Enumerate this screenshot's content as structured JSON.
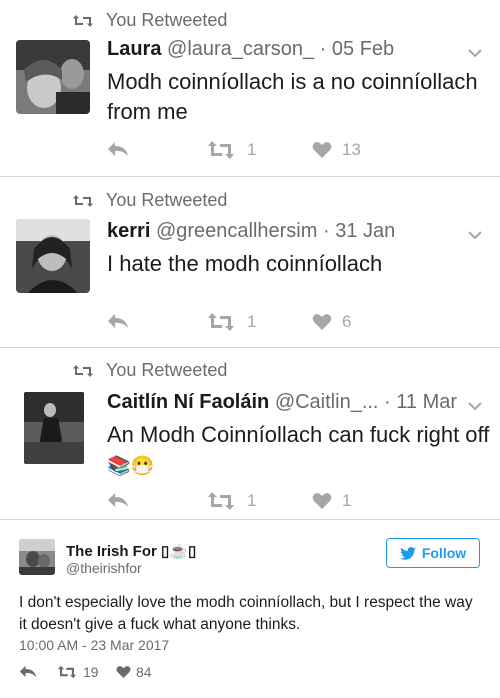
{
  "retweet_label": "You Retweeted",
  "tweets": [
    {
      "name": "Laura",
      "handle": "@laura_carson_",
      "date": "05 Feb",
      "text": "Modh coinníollach is a no coinníollach from me",
      "emoji": "",
      "retweets": "1",
      "likes": "13"
    },
    {
      "name": "kerri",
      "handle": "@greencallhersim",
      "date": "31 Jan",
      "text": "I hate the modh coinníollach",
      "emoji": "",
      "retweets": "1",
      "likes": "6"
    },
    {
      "name": "Caitlín Ní Faoláin",
      "handle": "@Caitlin_...",
      "date": "11 Mar",
      "text": "An Modh Coinníollach can fuck right off",
      "emoji": "📚😷",
      "retweets": "1",
      "likes": "1"
    }
  ],
  "embed": {
    "name": "The Irish For ▯☕▯",
    "handle": "@theirishfor",
    "follow_label": "Follow",
    "text": "I don't especially love the modh coinníollach, but I respect the way it doesn't give a fuck what anyone thinks.",
    "timestamp": "10:00 AM - 23 Mar 2017",
    "retweets": "19",
    "likes": "84"
  },
  "colors": {
    "grey_icon": "#a6a6a6",
    "twitter_blue": "#1d9bf0"
  },
  "icons": [
    "retweet-icon",
    "reply-icon",
    "heart-icon",
    "chevron-down-icon",
    "twitter-bird-icon"
  ]
}
